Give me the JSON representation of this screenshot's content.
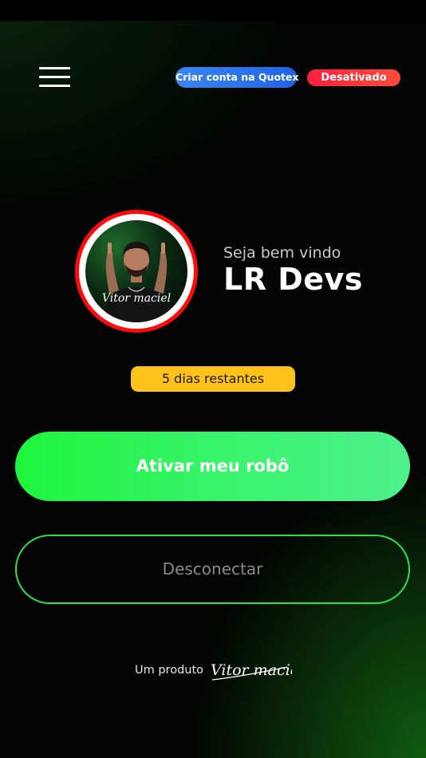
{
  "header": {
    "menu_icon": "hamburger-menu-icon",
    "create_account_label": "Criar conta na Quotex",
    "status_label": "Desativado",
    "colors": {
      "create_account_bg": "#2f7bf0",
      "status_bg": "#ff2a3c"
    }
  },
  "profile": {
    "avatar_signature": "Vitor maciel",
    "avatar_ring_color": "#ff0b0b",
    "welcome_text": "Seja bem vindo",
    "username": "LR Devs"
  },
  "subscription": {
    "days_remaining_label": "5 dias restantes",
    "badge_color": "#ffc21a"
  },
  "actions": {
    "activate_label": "Ativar meu robô",
    "disconnect_label": "Desconectar",
    "accent_color": "#2be04b"
  },
  "footer": {
    "product_text": "Um produto",
    "brand_signature": "Vitor maciel"
  }
}
